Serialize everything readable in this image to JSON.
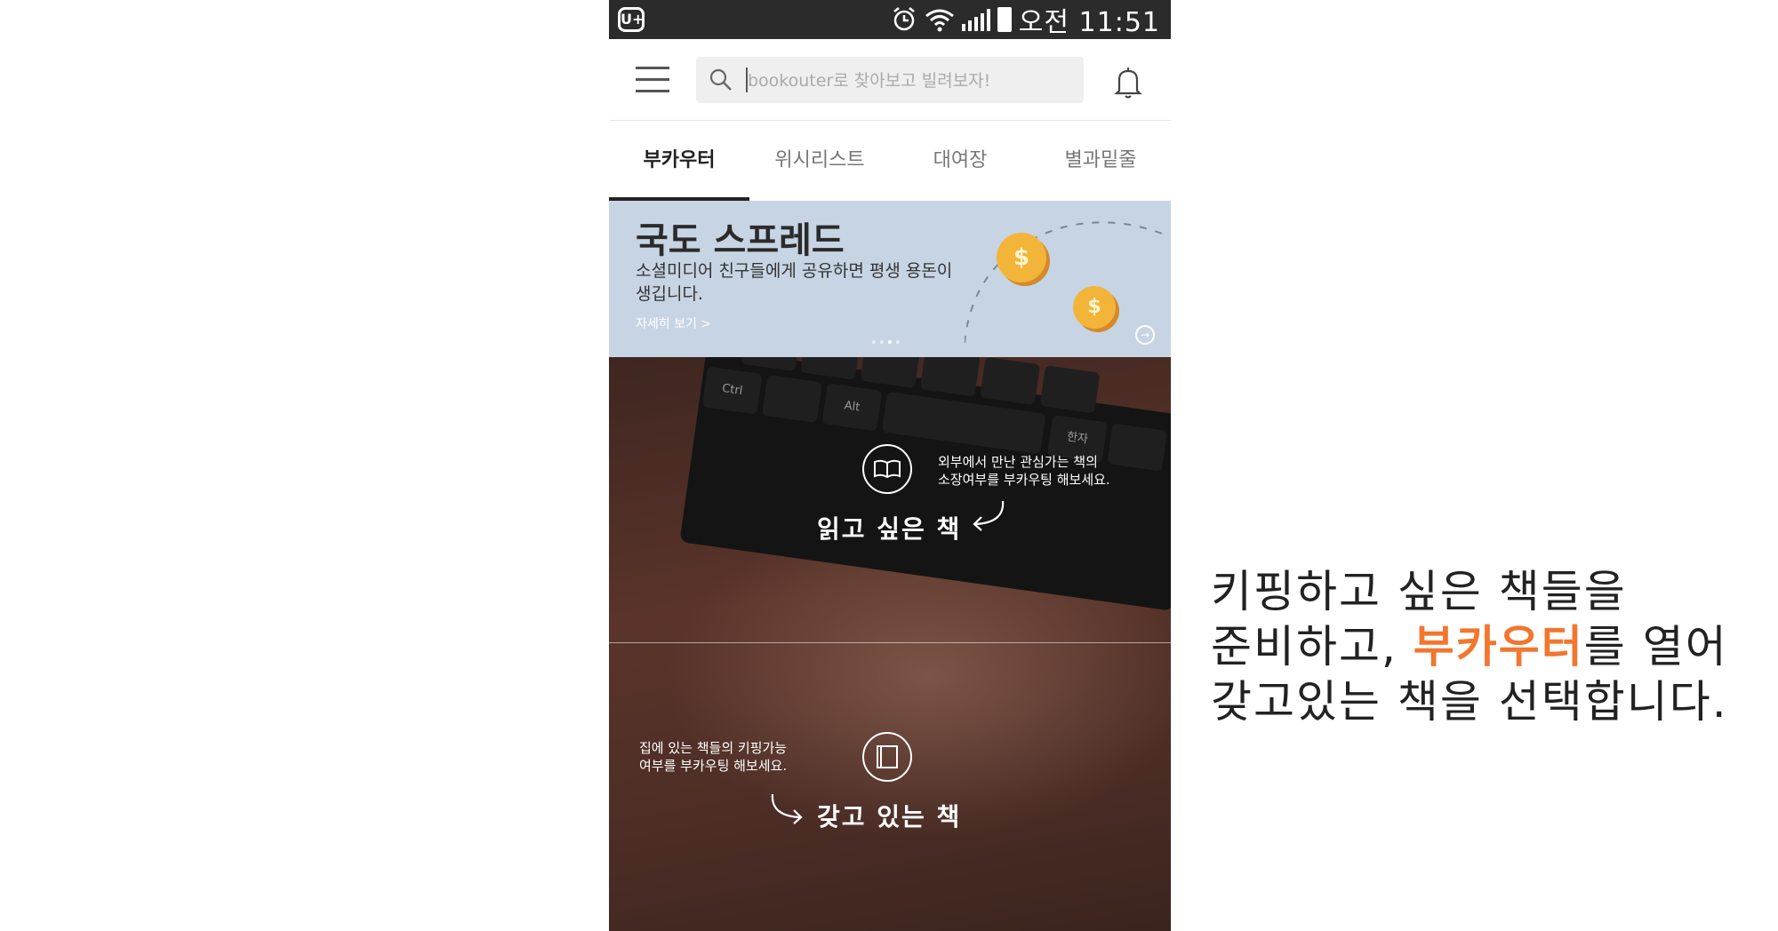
{
  "status_bar": {
    "carrier_logo": "U+",
    "time": "오전 11:51"
  },
  "header": {
    "search_placeholder": "bookouter로 찾아보고 빌려보자!"
  },
  "tabs": [
    {
      "label": "부카우터",
      "active": true
    },
    {
      "label": "위시리스트",
      "active": false
    },
    {
      "label": "대여장",
      "active": false
    },
    {
      "label": "별과밑줄",
      "active": false
    }
  ],
  "banner": {
    "title": "국도 스프레드",
    "description": "소셜미디어 친구들에게 공유하면 평생 용돈이 생깁니다.",
    "link": "자세히 보기 >",
    "coin_symbol": "$"
  },
  "photo": {
    "keys": [
      "Ctrl",
      "Alt",
      "한자"
    ],
    "top_hint": "외부에서 만난 관심가는 책의\n소장여부를 부카우팅 해보세요.",
    "top_label": "읽고 싶은 책",
    "bottom_hint": "집에 있는 책들의 키핑가능\n여부를 부카우팅 해보세요.",
    "bottom_label": "갖고 있는 책"
  },
  "caption": {
    "line1": "키핑하고 싶은 책들을",
    "line2_pre": "준비하고, ",
    "line2_highlight": "부카우터",
    "line2_post": "를 열어",
    "line3": "갖고있는 책을 선택합니다.",
    "highlight_color": "#f2762e"
  }
}
